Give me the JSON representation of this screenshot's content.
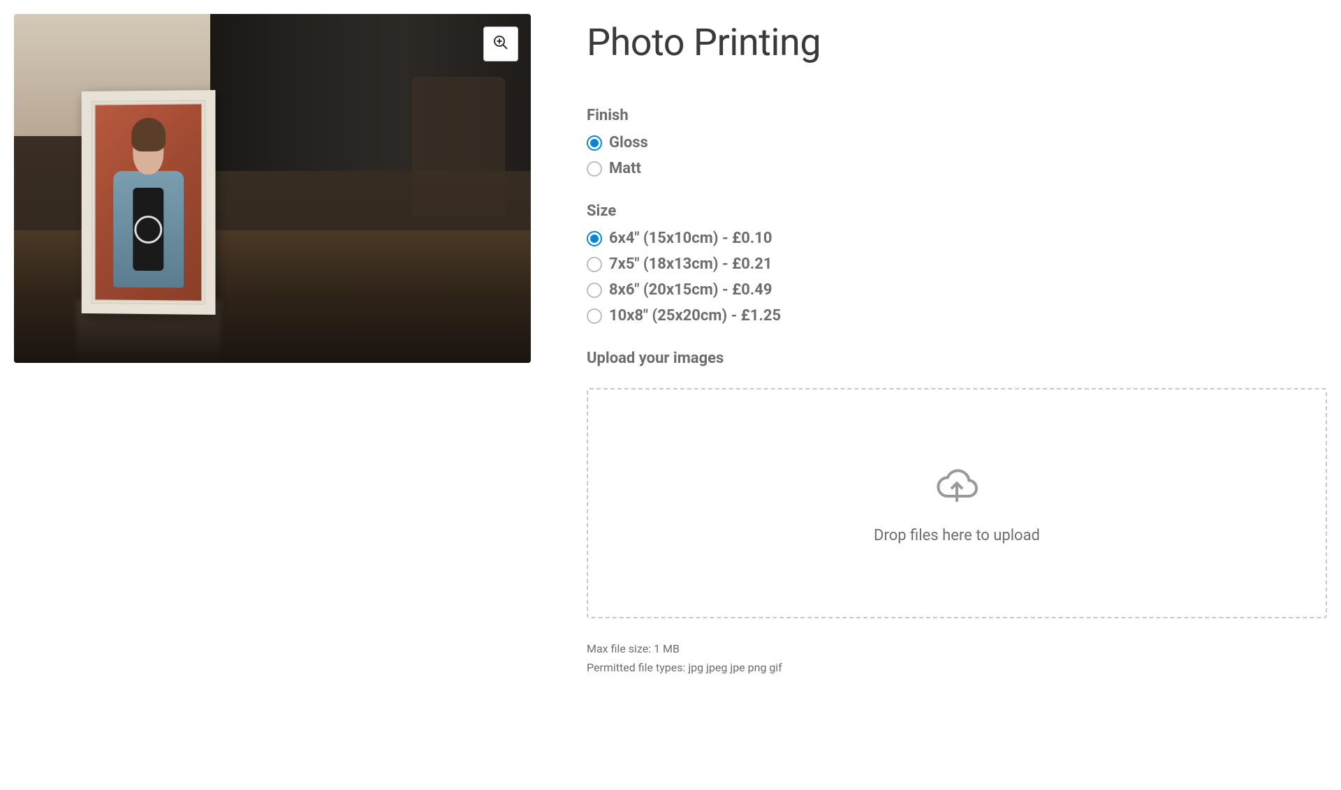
{
  "product": {
    "title": "Photo Printing"
  },
  "finish": {
    "label": "Finish",
    "options": [
      {
        "label": "Gloss",
        "selected": true
      },
      {
        "label": "Matt",
        "selected": false
      }
    ]
  },
  "size": {
    "label": "Size",
    "options": [
      {
        "label": "6x4\" (15x10cm) - £0.10",
        "selected": true
      },
      {
        "label": "7x5\" (18x13cm) - £0.21",
        "selected": false
      },
      {
        "label": "8x6\" (20x15cm) - £0.49",
        "selected": false
      },
      {
        "label": "10x8\" (25x20cm) - £1.25",
        "selected": false
      }
    ]
  },
  "upload": {
    "label": "Upload your images",
    "dropzone_text": "Drop files here to upload",
    "max_size_text": "Max file size: 1 MB",
    "permitted_types_text": "Permitted file types: jpg jpeg jpe png gif"
  }
}
